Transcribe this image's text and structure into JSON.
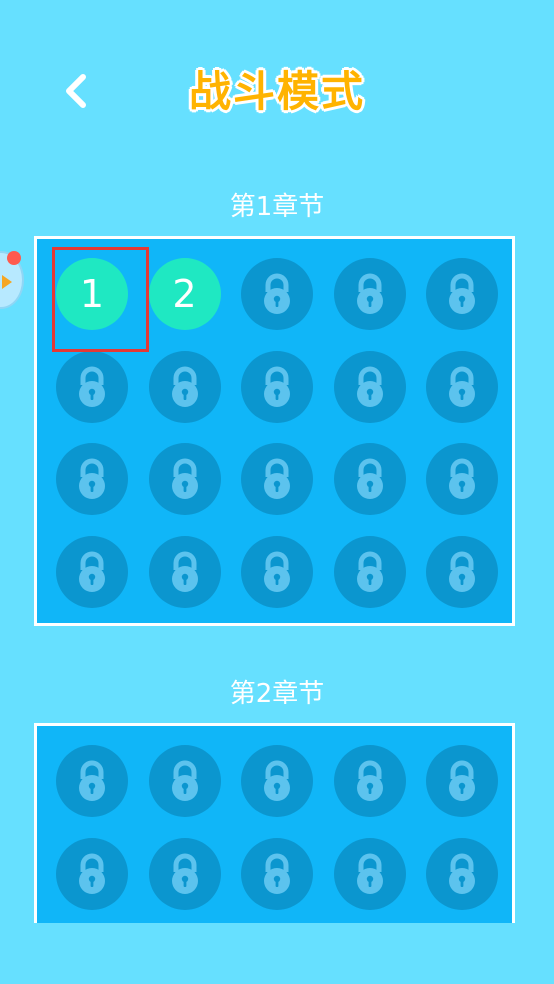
{
  "header": {
    "title": "战斗模式"
  },
  "colors": {
    "background": "#66e0ff",
    "panel": "#10b6f8",
    "locked_circle": "#0b96cf",
    "lock_glyph": "#5cc3ee",
    "unlocked_circle": "#1fe8c2",
    "title_orange": "#ffb300",
    "highlight_red": "#e53935"
  },
  "chapters": [
    {
      "label": "第1章节",
      "levels": [
        {
          "number": "1",
          "locked": false
        },
        {
          "number": "2",
          "locked": false
        },
        {
          "locked": true
        },
        {
          "locked": true
        },
        {
          "locked": true
        },
        {
          "locked": true
        },
        {
          "locked": true
        },
        {
          "locked": true
        },
        {
          "locked": true
        },
        {
          "locked": true
        },
        {
          "locked": true
        },
        {
          "locked": true
        },
        {
          "locked": true
        },
        {
          "locked": true
        },
        {
          "locked": true
        },
        {
          "locked": true
        },
        {
          "locked": true
        },
        {
          "locked": true
        },
        {
          "locked": true
        },
        {
          "locked": true
        }
      ]
    },
    {
      "label": "第2章节",
      "levels": [
        {
          "locked": true
        },
        {
          "locked": true
        },
        {
          "locked": true
        },
        {
          "locked": true
        },
        {
          "locked": true
        },
        {
          "locked": true
        },
        {
          "locked": true
        },
        {
          "locked": true
        },
        {
          "locked": true
        },
        {
          "locked": true
        }
      ]
    }
  ]
}
